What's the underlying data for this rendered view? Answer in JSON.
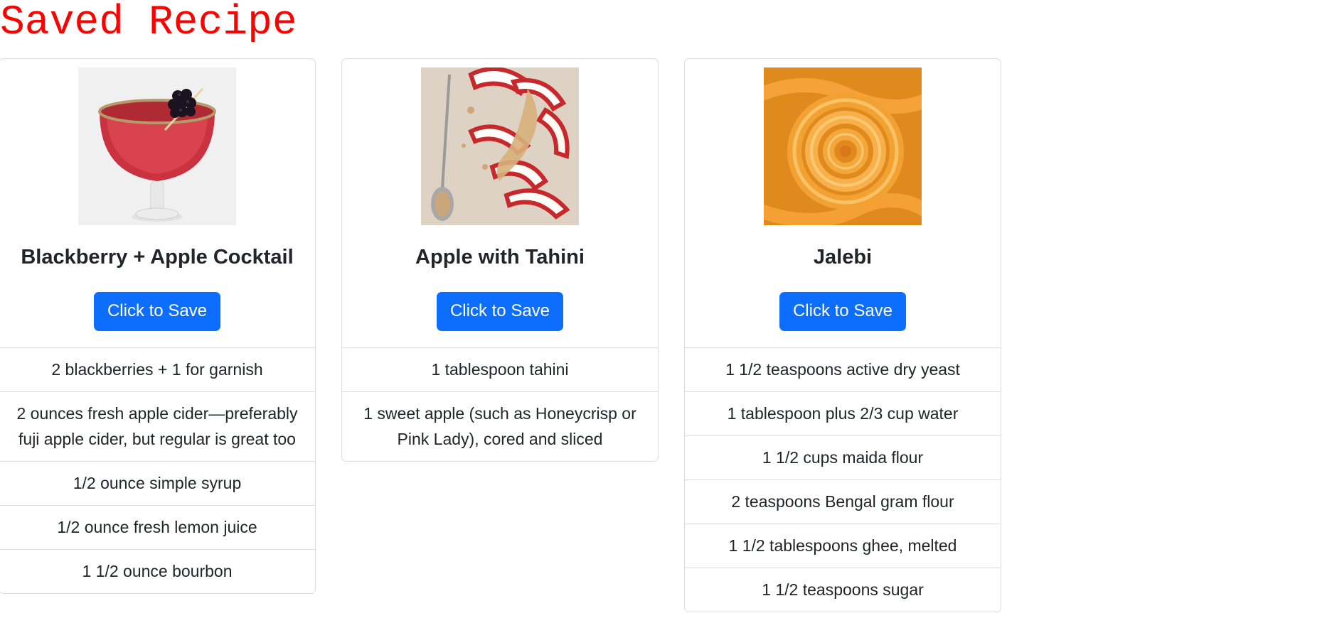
{
  "page": {
    "title": "Saved Recipe"
  },
  "colors": {
    "title": "#ff0000",
    "button": "#0d6efd",
    "border": "#dcdcdc"
  },
  "recipes": [
    {
      "title": "Blackberry + Apple Cocktail",
      "image_icon": "cocktail-photo",
      "button_label": "Click to Save",
      "ingredients": [
        "2 blackberries + 1 for garnish",
        "2 ounces fresh apple cider—preferably fuji apple cider, but regular is great too",
        "1/2 ounce simple syrup",
        "1/2 ounce fresh lemon juice",
        "1 1/2 ounce bourbon"
      ]
    },
    {
      "title": "Apple with Tahini",
      "image_icon": "apple-tahini-photo",
      "button_label": "Click to Save",
      "ingredients": [
        "1 tablespoon tahini",
        "1 sweet apple (such as Honeycrisp or Pink Lady), cored and sliced"
      ]
    },
    {
      "title": "Jalebi",
      "image_icon": "jalebi-photo",
      "button_label": "Click to Save",
      "ingredients": [
        "1 1/2 teaspoons active dry yeast",
        "1 tablespoon plus 2/3 cup water",
        "1 1/2 cups maida flour",
        "2 teaspoons Bengal gram flour",
        "1 1/2 tablespoons ghee, melted",
        "1 1/2 teaspoons sugar"
      ]
    }
  ]
}
